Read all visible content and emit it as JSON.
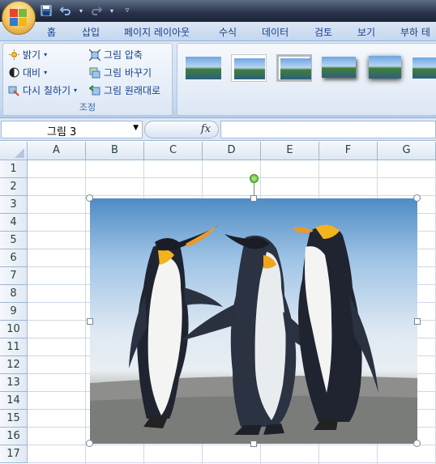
{
  "quick_access": {
    "save_icon": "save-icon",
    "undo_icon": "undo-icon",
    "redo_icon": "redo-icon"
  },
  "tabs": [
    "홈",
    "삽입",
    "페이지 레이아웃",
    "수식",
    "데이터",
    "검토",
    "보기",
    "부하 테스"
  ],
  "ribbon": {
    "adjust_group": {
      "brightness": "밝기",
      "contrast": "대비",
      "recolor": "다시 칠하기",
      "compress": "그림 압축",
      "change_picture": "그림 바꾸기",
      "reset_picture": "그림 원래대로",
      "label": "조정"
    }
  },
  "formula_bar": {
    "name_box": "그림 3",
    "fx": "fx",
    "formula": ""
  },
  "columns": [
    "A",
    "B",
    "C",
    "D",
    "E",
    "F",
    "G"
  ],
  "rows": [
    "1",
    "2",
    "3",
    "4",
    "5",
    "6",
    "7",
    "8",
    "9",
    "10",
    "11",
    "12",
    "13",
    "14",
    "15",
    "16",
    "17"
  ],
  "picture": {
    "subject": "penguins"
  }
}
